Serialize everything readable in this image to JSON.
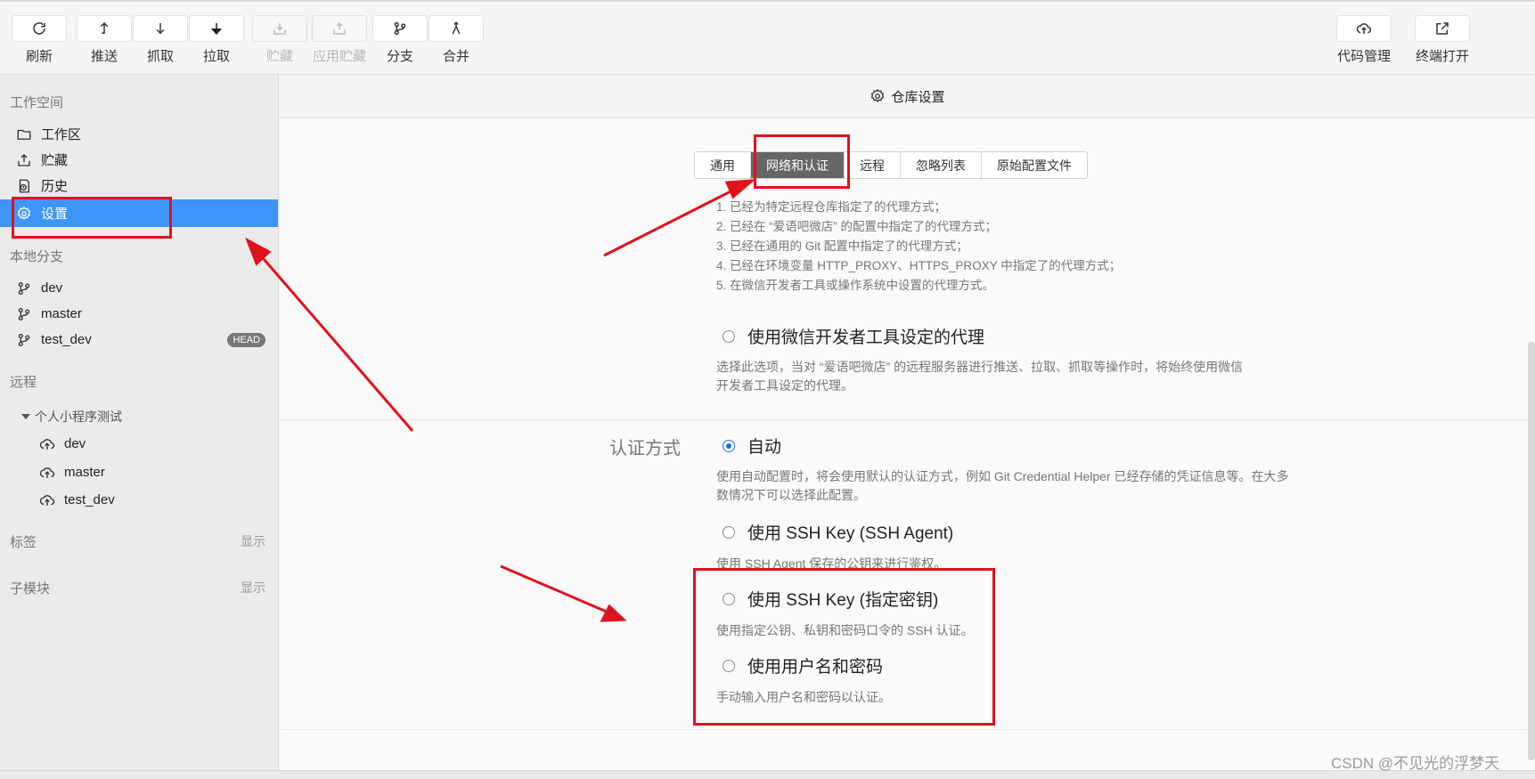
{
  "toolbar": {
    "buttons": [
      {
        "label": "刷新",
        "icon": "refresh-icon"
      },
      {
        "label": "推送",
        "icon": "push-icon"
      },
      {
        "label": "抓取",
        "icon": "fetch-icon"
      },
      {
        "label": "拉取",
        "icon": "pull-icon"
      },
      {
        "label": "贮藏",
        "icon": "stash-icon",
        "disabled": true
      },
      {
        "label": "应用贮藏",
        "icon": "apply-stash-icon",
        "disabled": true
      },
      {
        "label": "分支",
        "icon": "branch-icon"
      },
      {
        "label": "合并",
        "icon": "merge-icon"
      }
    ],
    "right_buttons": [
      {
        "label": "代码管理",
        "icon": "cloud-upload-icon"
      },
      {
        "label": "终端打开",
        "icon": "external-open-icon"
      }
    ]
  },
  "sidebar": {
    "workspace_title": "工作空间",
    "workspace_items": [
      {
        "label": "工作区",
        "icon": "folder-icon"
      },
      {
        "label": "贮藏",
        "icon": "stash-icon"
      },
      {
        "label": "历史",
        "icon": "history-icon"
      },
      {
        "label": "设置",
        "icon": "gear-icon",
        "active": true
      }
    ],
    "local_branches_title": "本地分支",
    "local_branches": [
      {
        "label": "dev"
      },
      {
        "label": "master"
      },
      {
        "label": "test_dev",
        "badge": "HEAD"
      }
    ],
    "remote_title": "远程",
    "remote_group": "个人小程序测试",
    "remote_branches": [
      {
        "label": "dev"
      },
      {
        "label": "master"
      },
      {
        "label": "test_dev"
      }
    ],
    "tags_title": "标签",
    "tags_toggle": "显示",
    "submodules_title": "子模块",
    "submodules_toggle": "显示"
  },
  "main": {
    "header": "仓库设置",
    "tabs": [
      {
        "label": "通用"
      },
      {
        "label": "网络和认证",
        "active": true
      },
      {
        "label": "远程"
      },
      {
        "label": "忽略列表"
      },
      {
        "label": "原始配置文件"
      }
    ],
    "proxy_notes": [
      "1. 已经为特定远程仓库指定了的代理方式；",
      "2. 已经在 “爱语吧微店” 的配置中指定了的代理方式；",
      "3. 已经在通用的 Git 配置中指定了的代理方式；",
      "4. 已经在环境变量 HTTP_PROXY、HTTPS_PROXY 中指定了的代理方式；",
      "5. 在微信开发者工具或操作系统中设置的代理方式。"
    ],
    "proxy_option": {
      "label": "使用微信开发者工具设定的代理",
      "desc_line1": "选择此选项，当对 “爱语吧微店” 的远程服务器进行推送、拉取、抓取等操作时，将始终使用微信",
      "desc_line2": "开发者工具设定的代理。"
    },
    "auth_label": "认证方式",
    "auth_options": [
      {
        "label": "自动",
        "checked": true,
        "desc_line1": "使用自动配置时，将会使用默认的认证方式，例如 Git Credential Helper 已经存储的凭证信息等。在大多",
        "desc_line2": "数情况下可以选择此配置。"
      },
      {
        "label": "使用 SSH Key (SSH Agent)",
        "checked": false,
        "desc_line1": "使用 SSH Agent 保存的公钥来进行鉴权。"
      },
      {
        "label": "使用 SSH Key (指定密钥)",
        "checked": false,
        "desc_line1": "使用指定公钥、私钥和密码口令的 SSH 认证。"
      },
      {
        "label": "使用用户名和密码",
        "checked": false,
        "desc_line1": "手动输入用户名和密码以认证。"
      }
    ]
  },
  "watermark": "CSDN @不见光的浮梦天",
  "annotation_color": "#e0121b",
  "accent_color": "#3d95f7"
}
